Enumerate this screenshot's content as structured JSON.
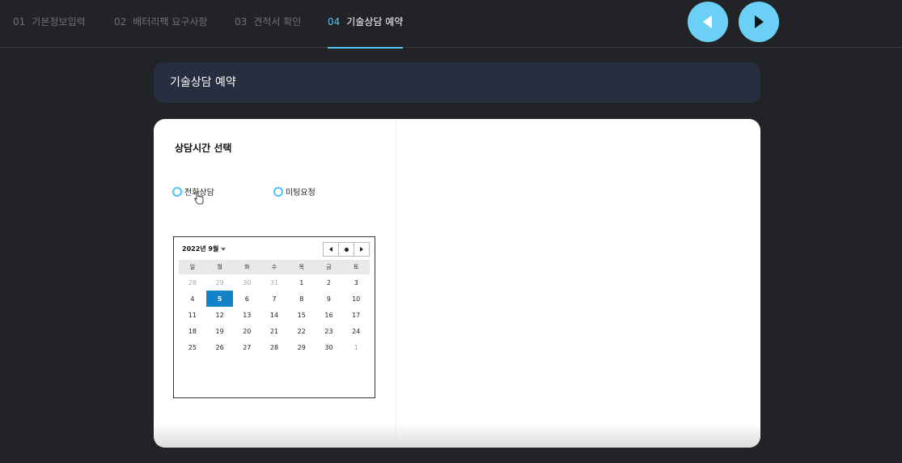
{
  "steps": [
    {
      "num": "01",
      "label": "기본정보입력"
    },
    {
      "num": "02",
      "label": "배터리팩 요구사항"
    },
    {
      "num": "03",
      "label": "견적서 확인"
    },
    {
      "num": "04",
      "label": "기술상담 예약"
    }
  ],
  "active_step": 3,
  "nav": {
    "prev_icon": "triangle-left-icon",
    "next_icon": "triangle-right-icon",
    "accent": "#6ccff6"
  },
  "panel_title": "기술상담 예약",
  "section_title": "상담시간 선택",
  "options": [
    {
      "label": "전화상담",
      "selected": false
    },
    {
      "label": "미팅요청",
      "selected": false
    }
  ],
  "calendar": {
    "month_label": "2022년 9월",
    "weekdays": [
      "일",
      "월",
      "화",
      "수",
      "목",
      "금",
      "토"
    ],
    "weeks": [
      [
        "28",
        "29",
        "30",
        "31",
        "1",
        "2",
        "3"
      ],
      [
        "4",
        "5",
        "6",
        "7",
        "8",
        "9",
        "10"
      ],
      [
        "11",
        "12",
        "13",
        "14",
        "15",
        "16",
        "17"
      ],
      [
        "18",
        "19",
        "20",
        "21",
        "22",
        "23",
        "24"
      ],
      [
        "25",
        "26",
        "27",
        "28",
        "29",
        "30",
        "1"
      ]
    ],
    "selected_day": "5",
    "selected_color": "#1283c6"
  }
}
